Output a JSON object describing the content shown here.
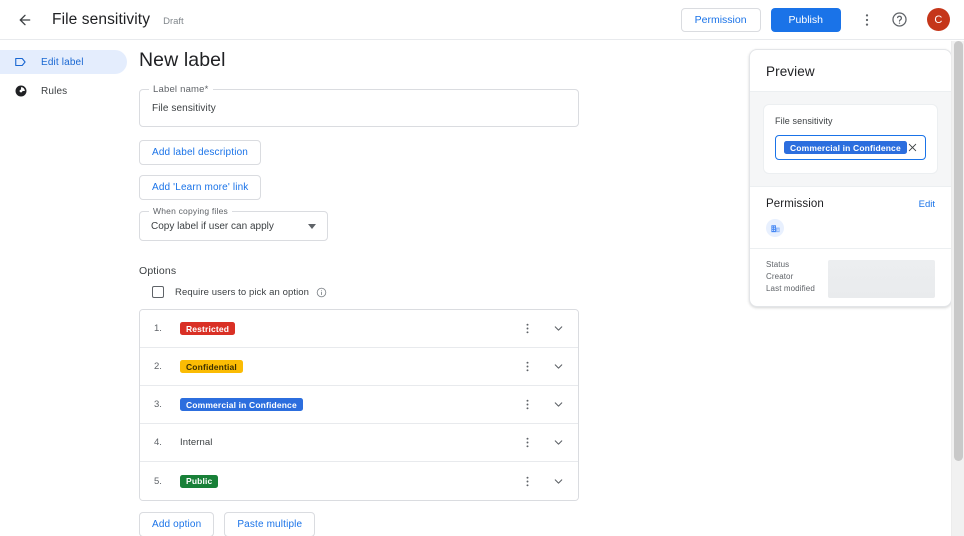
{
  "topbar": {
    "back_icon": "arrow-left-icon",
    "title": "File sensitivity",
    "status": "Draft",
    "permission_button": "Permission",
    "publish_button": "Publish",
    "kebab_icon": "more-vert-icon",
    "help_icon": "help-circle-icon",
    "avatar_letter": "C",
    "avatar_color": "#c5361a",
    "accent_color": "#1a73e8"
  },
  "sidebar": {
    "items": [
      {
        "label": "Edit label",
        "icon": "label-tag-icon",
        "active": true
      },
      {
        "label": "Rules",
        "icon": "rules-circle-icon",
        "active": false
      }
    ]
  },
  "main": {
    "page_title": "New label",
    "label_name_field": {
      "legend": "Label name*",
      "value": "File sensitivity"
    },
    "add_description_button": "Add label description",
    "add_learn_more_button": "Add 'Learn more' link",
    "copying_select": {
      "legend": "When copying files",
      "value": "Copy label if user can apply"
    },
    "options_heading": "Options",
    "require_option_checkbox": {
      "label": "Require users to pick an option",
      "checked": false,
      "info_icon": "info-circle-icon"
    },
    "options": [
      {
        "num": "1.",
        "label": "Restricted",
        "chip": true,
        "bg": "#d93025",
        "fg": "#ffffff"
      },
      {
        "num": "2.",
        "label": "Confidential",
        "chip": true,
        "bg": "#fbbc04",
        "fg": "#3c2f00"
      },
      {
        "num": "3.",
        "label": "Commercial in Confidence",
        "chip": true,
        "bg": "#2c6ede",
        "fg": "#ffffff"
      },
      {
        "num": "4.",
        "label": "Internal",
        "chip": false,
        "bg": "",
        "fg": "#3c4043"
      },
      {
        "num": "5.",
        "label": "Public",
        "chip": true,
        "bg": "#188038",
        "fg": "#ffffff"
      }
    ],
    "row_kebab_icon": "more-vert-icon",
    "row_expand_icon": "chevron-down-icon",
    "add_option_button": "Add option",
    "paste_multiple_button": "Paste multiple"
  },
  "preview": {
    "heading": "Preview",
    "card_title": "File sensitivity",
    "selected_chip": "Commercial in Confidence",
    "selected_chip_bg": "#2c6ede",
    "clear_icon": "close-x-icon",
    "permission_heading": "Permission",
    "edit_link": "Edit",
    "permission_icon": "organization-building-icon",
    "meta_keys": [
      "Status",
      "Creator",
      "Last modified"
    ]
  }
}
